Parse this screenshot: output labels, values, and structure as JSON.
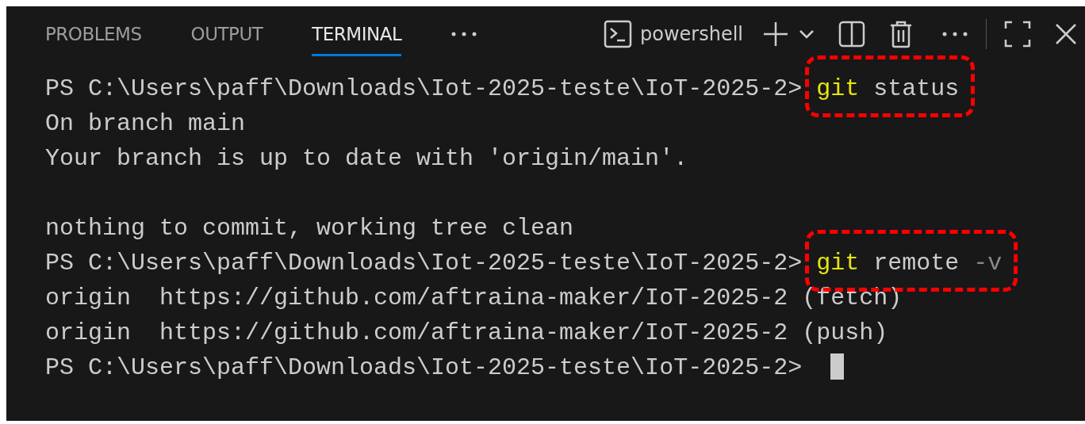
{
  "tabs": [
    {
      "label": "PROBLEMS",
      "selected": false
    },
    {
      "label": "OUTPUT",
      "selected": false
    },
    {
      "label": "TERMINAL",
      "selected": true
    }
  ],
  "toolbar": {
    "shell": "powershell"
  },
  "terminal": {
    "lines": [
      {
        "kind": "prompt",
        "prompt": "PS C:\\Users\\paff\\Downloads\\Iot-2025-teste\\IoT-2025-2>",
        "command": [
          {
            "kind": "program",
            "text": "git"
          },
          {
            "kind": "arg",
            "text": "status"
          }
        ],
        "highlighted": true
      },
      {
        "kind": "output",
        "text": "On branch main"
      },
      {
        "kind": "output",
        "text": "Your branch is up to date with 'origin/main'."
      },
      {
        "kind": "blank"
      },
      {
        "kind": "output",
        "text": "nothing to commit, working tree clean"
      },
      {
        "kind": "prompt",
        "prompt": "PS C:\\Users\\paff\\Downloads\\Iot-2025-teste\\IoT-2025-2>",
        "command": [
          {
            "kind": "program",
            "text": "git"
          },
          {
            "kind": "arg",
            "text": "remote"
          },
          {
            "kind": "flag",
            "text": "-v"
          }
        ],
        "highlighted": true
      },
      {
        "kind": "output",
        "text": "origin  https://github.com/aftraina-maker/IoT-2025-2 (fetch)"
      },
      {
        "kind": "output",
        "text": "origin  https://github.com/aftraina-maker/IoT-2025-2 (push)"
      },
      {
        "kind": "prompt",
        "prompt": "PS C:\\Users\\paff\\Downloads\\Iot-2025-teste\\IoT-2025-2>",
        "cursor": true
      }
    ]
  }
}
